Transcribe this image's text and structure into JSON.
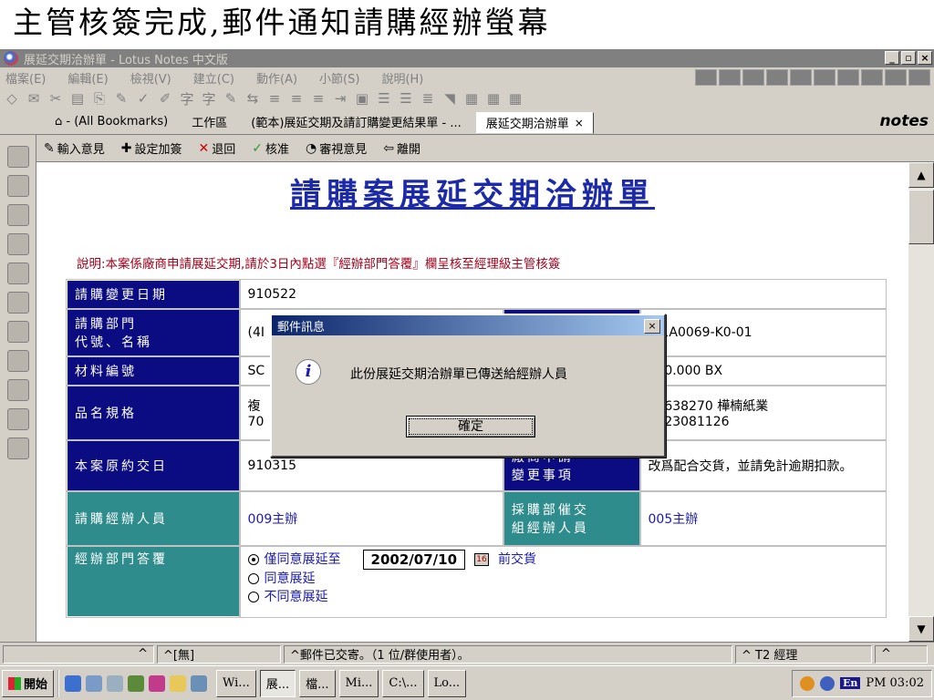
{
  "slide_caption": "主管核簽完成,郵件通知請購經辦螢幕",
  "window": {
    "title": "展延交期洽辦單 - Lotus Notes 中文版",
    "min": "_",
    "max": "▫",
    "close": "×"
  },
  "menu": [
    "檔案(E)",
    "編輯(E)",
    "檢視(V)",
    "建立(C)",
    "動作(A)",
    "小節(S)",
    "說明(H)"
  ],
  "toolbar_icons": [
    "◇",
    "✉",
    "✂",
    "▤",
    "⎘",
    "✎",
    "✓",
    "✐",
    "字",
    "字",
    "✎",
    "⇆",
    "≡",
    "≡",
    "≡",
    "⇥",
    "▣",
    "☰",
    "☰",
    "≣",
    "◥",
    "▦",
    "▦",
    "▦"
  ],
  "bookmarks": {
    "home_label": "⌂ - (All Bookmarks)",
    "workspace": "工作區",
    "template_tab": "(範本)展延交期及請訂購變更結果單 - ...",
    "active_tab": "展延交期洽辦單",
    "tab_close": "×",
    "brand": "notes"
  },
  "actions": [
    {
      "label": "輸入意見",
      "glyph": "✎"
    },
    {
      "label": "設定加簽",
      "glyph": "✚"
    },
    {
      "label": "退回",
      "glyph": "✕"
    },
    {
      "label": "核准",
      "glyph": "✓"
    },
    {
      "label": "審視意見",
      "glyph": "◔"
    },
    {
      "label": "離開",
      "glyph": "⇦"
    }
  ],
  "doc": {
    "title": "請購案展延交期洽辦單",
    "note": "說明:本案係廠商申請展延交期,請於3日內點選『經辦部門答覆』欄呈核至經理級主管核簽",
    "rows": {
      "change_date_label": "請購變更日期",
      "change_date_value": "910522",
      "dept_label_1": "請購部門",
      "dept_label_2": "代號、名稱",
      "dept_value": "(4I",
      "order_no_value": "4-1A0069-K0-01",
      "material_label": "材料編號",
      "material_value": "SC",
      "qty_value": "200.000 BX",
      "spec_label": "品名規格",
      "spec_value_1": "複",
      "spec_value_2": "70",
      "vendor_value_1": "22638270 樺楠紙業",
      "vendor_value_2": "0223081126",
      "orig_date_label": "本案原約交日",
      "orig_date_value": "910315",
      "vendor_req_label_1": "廠商申請",
      "vendor_req_label_2": "變更事項",
      "vendor_req_value": "改爲配合交貨，並請免計逾期扣款。",
      "buyer_label": "請購經辦人員",
      "buyer_value": "009主辦",
      "purchaser_label_1": "採購部催交",
      "purchaser_label_2": "組經辦人員",
      "purchaser_value": "005主辦",
      "reply_label": "經辦部門答覆",
      "reply_options": [
        "僅同意展延至",
        "同意展延",
        "不同意展延"
      ],
      "reply_date": "2002/07/10",
      "reply_cal": "16",
      "reply_suffix": "前交貨"
    }
  },
  "dialog": {
    "title": "郵件訊息",
    "close": "×",
    "icon": "i",
    "message": "此份展延交期洽辦單已傳送給經辦人員",
    "ok": "確定"
  },
  "status": {
    "cell1": "^",
    "cell2": "^[無]",
    "cell3": "^郵件已交寄。（1 位/群使用者）。",
    "cell4": "^ T2 經理",
    "cell5": "^"
  },
  "taskbar": {
    "start": "開始",
    "tasks": [
      "Wi...",
      "展...",
      "檔...",
      "Mi...",
      "C:\\...",
      "Lo..."
    ],
    "lang": "En",
    "clock": "PM 03:02"
  },
  "colors": {
    "label_navy": "#0c0c82",
    "label_teal": "#2e8c8c",
    "title_blue": "#1c2aa8",
    "note_red": "#a4001a"
  }
}
